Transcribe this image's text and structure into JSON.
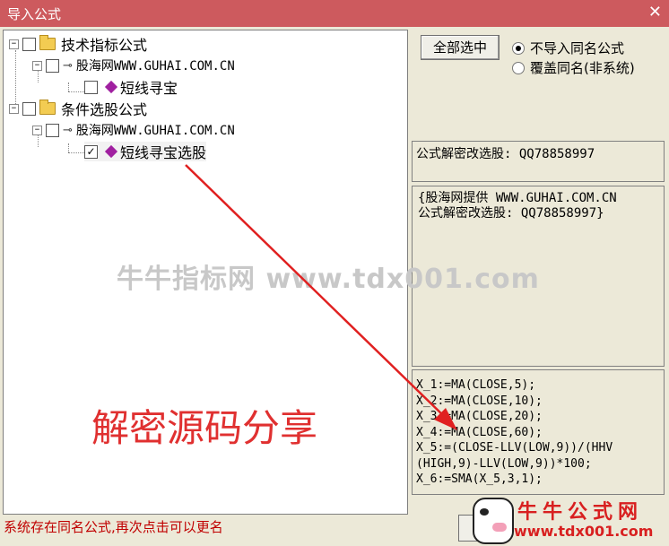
{
  "window": {
    "title": "导入公式",
    "close_glyph": "✕"
  },
  "tree": {
    "nodes": [
      {
        "label": "技术指标公式",
        "checked": false
      },
      {
        "label": "股海网WWW.GUHAI.COM.CN",
        "checked": false
      },
      {
        "label": "短线寻宝",
        "checked": false
      },
      {
        "label": "条件选股公式",
        "checked": false
      },
      {
        "label": "股海网WWW.GUHAI.COM.CN",
        "checked": false
      },
      {
        "label": "短线寻宝选股",
        "checked": true
      }
    ]
  },
  "controls": {
    "select_all_label": "全部选中",
    "radio_options": [
      {
        "label": "不导入同名公式",
        "selected": true
      },
      {
        "label": "覆盖同名(非系统)",
        "selected": false
      }
    ]
  },
  "info": {
    "name_line": "公式解密改选股: QQ78858997",
    "description_lines": [
      "{股海网提供 WWW.GUHAI.COM.CN",
      "公式解密改选股: QQ78858997}"
    ],
    "code_lines": [
      "X_1:=MA(CLOSE,5);",
      "X_2:=MA(CLOSE,10);",
      "X_3:=MA(CLOSE,20);",
      "X_4:=MA(CLOSE,60);",
      "X_5:=(CLOSE-LLV(LOW,9))/(HHV",
      "(HIGH,9)-LLV(LOW,9))*100;",
      "X_6:=SMA(X_5,3,1);"
    ]
  },
  "status": {
    "text": "系统存在同名公式,再次点击可以更名"
  },
  "overlay": {
    "watermark": "牛牛指标网 www.tdx001.com",
    "annotation": "解密源码分享",
    "logo_name": "牛牛公式网",
    "logo_url": "www.tdx001.com",
    "arrow_color": "#e02020"
  }
}
